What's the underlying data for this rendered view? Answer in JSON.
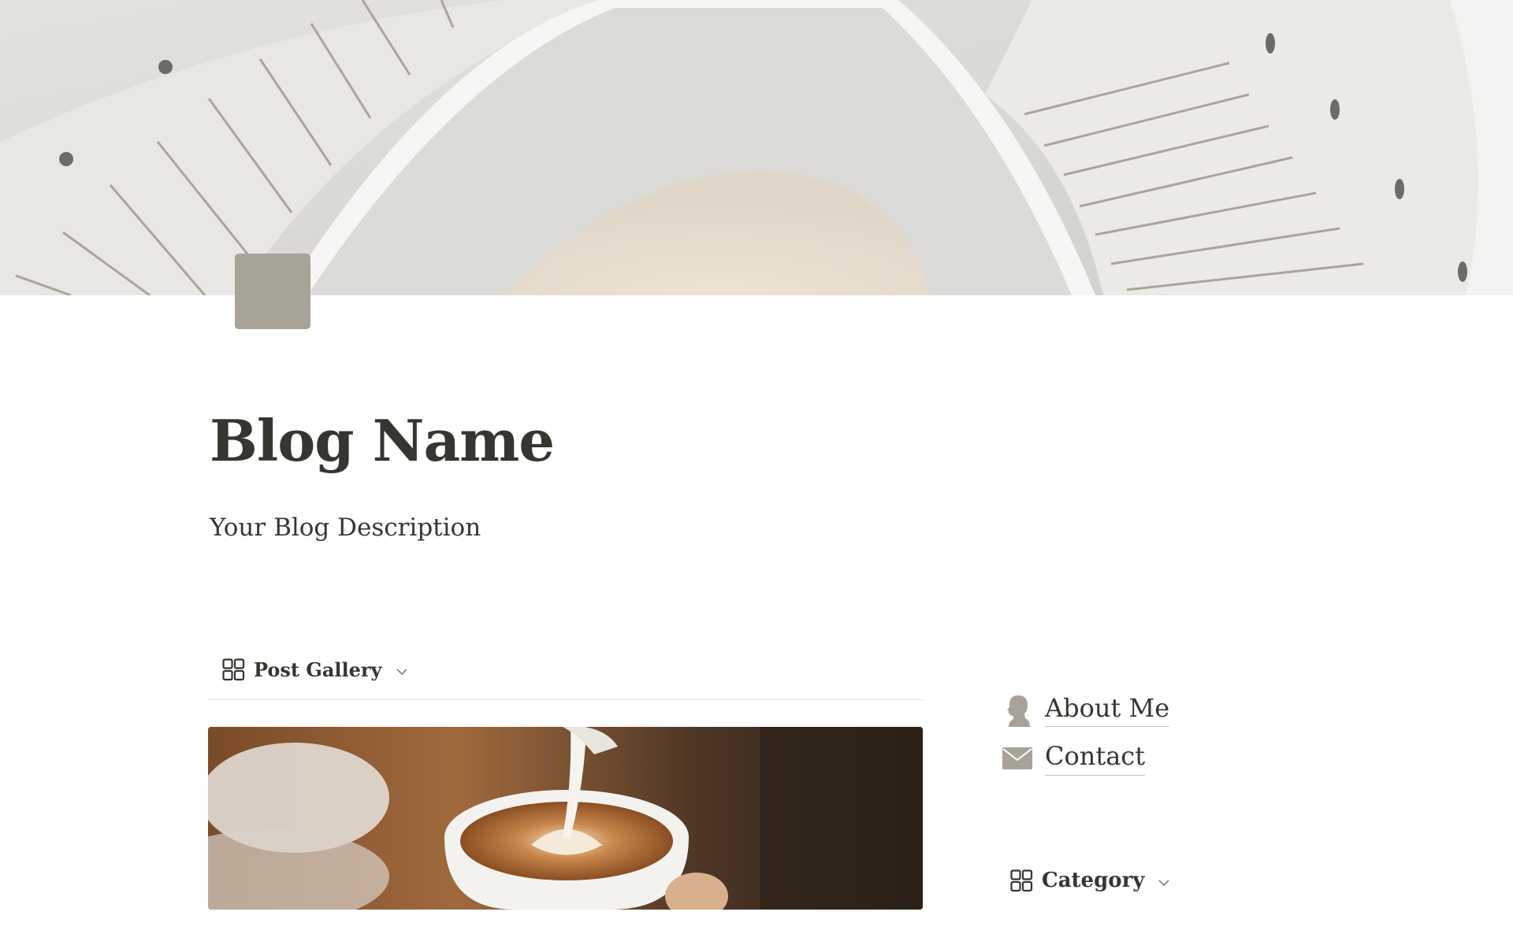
{
  "page": {
    "title": "Blog Name",
    "description": "Your Blog Description",
    "icon_color": "#a8a398"
  },
  "cover": {
    "image": "spiral-staircase-photo"
  },
  "gallery_view": {
    "icon": "gallery-grid-icon",
    "label": "Post Gallery",
    "card_image": "latte-art-coffee-photo"
  },
  "side_links": [
    {
      "icon": "person-silhouette-icon",
      "label": "About Me"
    },
    {
      "icon": "envelope-icon",
      "label": "Contact"
    }
  ],
  "category_view": {
    "icon": "gallery-grid-icon",
    "label": "Category"
  }
}
